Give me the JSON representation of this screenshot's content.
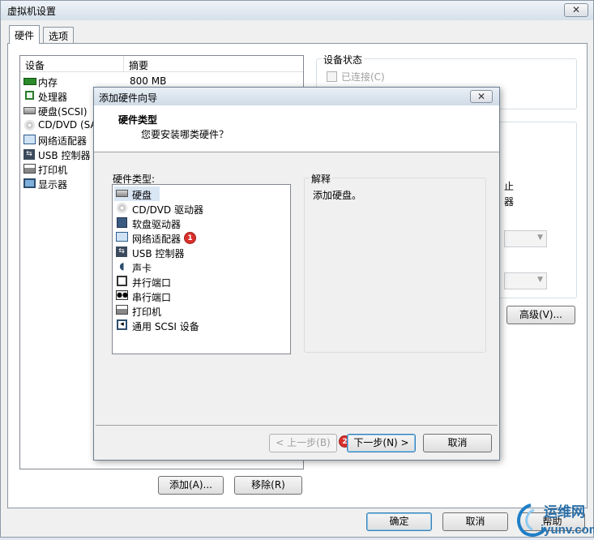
{
  "window": {
    "title": "虚拟机设置",
    "close_icon": "close-icon"
  },
  "tabs": [
    {
      "label": "硬件",
      "active": true
    },
    {
      "label": "选项",
      "active": false
    }
  ],
  "device_list": {
    "headers": {
      "device": "设备",
      "summary": "摘要"
    },
    "rows": [
      {
        "icon": "memory-icon",
        "device": "内存",
        "summary": "800 MB"
      },
      {
        "icon": "cpu-icon",
        "device": "处理器",
        "summary": ""
      },
      {
        "icon": "harddisk-icon",
        "device": "硬盘(SCSI)",
        "summary": ""
      },
      {
        "icon": "cdrom-icon",
        "device": "CD/DVD (SA",
        "summary": ""
      },
      {
        "icon": "network-icon",
        "device": "网络适配器",
        "summary": ""
      },
      {
        "icon": "usb-icon",
        "device": "USB 控制器",
        "summary": ""
      },
      {
        "icon": "printer-icon",
        "device": "打印机",
        "summary": ""
      },
      {
        "icon": "display-icon",
        "device": "显示器",
        "summary": ""
      }
    ]
  },
  "device_status": {
    "legend": "设备状态",
    "connected_label": "已连接(C)"
  },
  "right_panel": {
    "partial_text_1": "止",
    "partial_text_2": "器",
    "advanced_button": "高级(V)..."
  },
  "bottom": {
    "add_button": "添加(A)...",
    "remove_button": "移除(R)",
    "ok_button": "确定",
    "cancel_button": "取消",
    "help_button": "帮助"
  },
  "wizard": {
    "title": "添加硬件向导",
    "close_icon": "close-icon",
    "header_title": "硬件类型",
    "header_subtitle": "您要安装哪类硬件？",
    "list_label": "硬件类型:",
    "items": [
      {
        "icon": "harddisk-icon",
        "label": "硬盘",
        "selected": true
      },
      {
        "icon": "cdrom-icon",
        "label": "CD/DVD 驱动器",
        "selected": false
      },
      {
        "icon": "floppy-icon",
        "label": "软盘驱动器",
        "selected": false
      },
      {
        "icon": "network-icon",
        "label": "网络适配器",
        "selected": false
      },
      {
        "icon": "usb-icon",
        "label": "USB 控制器",
        "selected": false
      },
      {
        "icon": "sound-icon",
        "label": "声卡",
        "selected": false
      },
      {
        "icon": "parallel-port-icon",
        "label": "并行端口",
        "selected": false
      },
      {
        "icon": "serial-port-icon",
        "label": "串行端口",
        "selected": false
      },
      {
        "icon": "printer-icon",
        "label": "打印机",
        "selected": false
      },
      {
        "icon": "scsi-icon",
        "label": "通用 SCSI 设备",
        "selected": false
      }
    ],
    "explain_legend": "解释",
    "explain_text": "添加硬盘。",
    "back_button": "< 上一步(B)",
    "next_button": "下一步(N) >",
    "cancel_button": "取消",
    "badge_1": "1",
    "badge_2": "2"
  },
  "watermark": {
    "text_top": "运维网",
    "text_bottom": "iyunv.com"
  }
}
